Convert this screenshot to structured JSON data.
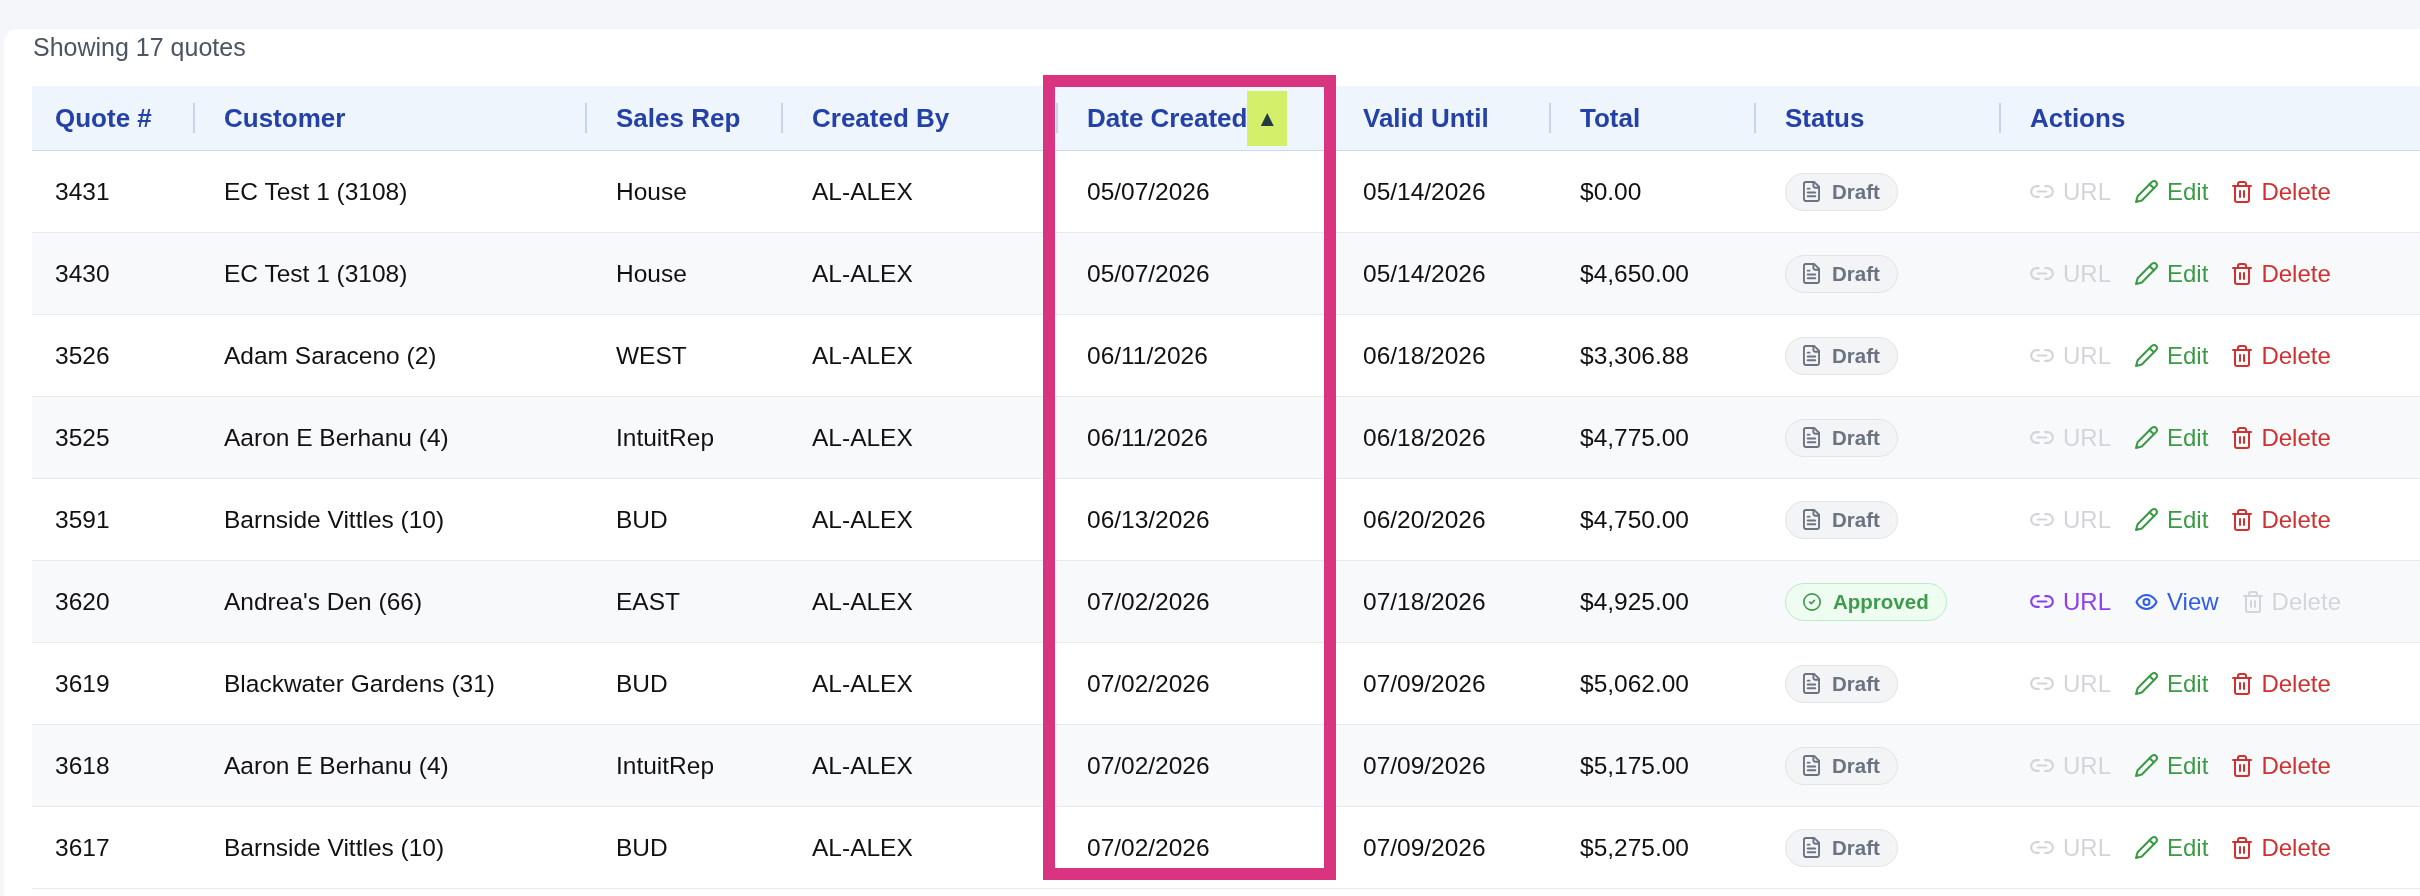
{
  "summary": "Showing 17 quotes",
  "table": {
    "columns": [
      {
        "label": "Quote #",
        "marked": false,
        "framed": false
      },
      {
        "label": "Customer",
        "marked": false,
        "framed": false
      },
      {
        "label": "Sales Rep",
        "marked": false,
        "framed": false
      },
      {
        "label": "Created By",
        "marked": false,
        "framed": false
      },
      {
        "label": "Date Created",
        "sort_indicator": "▲",
        "marked": true,
        "framed": true
      },
      {
        "label": "Valid Until",
        "marked": false,
        "framed": false
      },
      {
        "label": "Total",
        "marked": false,
        "framed": false
      },
      {
        "label": "Status",
        "marked": false,
        "framed": false
      },
      {
        "label": "Actions",
        "marked": false,
        "framed": false
      }
    ],
    "rows": [
      {
        "cells": [
          "3431",
          "EC Test 1 (3108)",
          "House",
          "AL-ALEX",
          "05/07/2026",
          "05/14/2026",
          "$0.00"
        ],
        "status": {
          "kind": "draft",
          "label": "Draft"
        },
        "actions": [
          {
            "kind": "url",
            "label": "URL",
            "disabled": true
          },
          {
            "kind": "edit",
            "label": "Edit",
            "disabled": false
          },
          {
            "kind": "delete",
            "label": "Delete",
            "disabled": false
          }
        ]
      },
      {
        "cells": [
          "3430",
          "EC Test 1 (3108)",
          "House",
          "AL-ALEX",
          "05/07/2026",
          "05/14/2026",
          "$4,650.00"
        ],
        "status": {
          "kind": "draft",
          "label": "Draft"
        },
        "actions": [
          {
            "kind": "url",
            "label": "URL",
            "disabled": true
          },
          {
            "kind": "edit",
            "label": "Edit",
            "disabled": false
          },
          {
            "kind": "delete",
            "label": "Delete",
            "disabled": false
          }
        ]
      },
      {
        "cells": [
          "3526",
          "Adam Saraceno (2)",
          "WEST",
          "AL-ALEX",
          "06/11/2026",
          "06/18/2026",
          "$3,306.88"
        ],
        "status": {
          "kind": "draft",
          "label": "Draft"
        },
        "actions": [
          {
            "kind": "url",
            "label": "URL",
            "disabled": true
          },
          {
            "kind": "edit",
            "label": "Edit",
            "disabled": false
          },
          {
            "kind": "delete",
            "label": "Delete",
            "disabled": false
          }
        ]
      },
      {
        "cells": [
          "3525",
          "Aaron E Berhanu (4)",
          "IntuitRep",
          "AL-ALEX",
          "06/11/2026",
          "06/18/2026",
          "$4,775.00"
        ],
        "status": {
          "kind": "draft",
          "label": "Draft"
        },
        "actions": [
          {
            "kind": "url",
            "label": "URL",
            "disabled": true
          },
          {
            "kind": "edit",
            "label": "Edit",
            "disabled": false
          },
          {
            "kind": "delete",
            "label": "Delete",
            "disabled": false
          }
        ]
      },
      {
        "cells": [
          "3591",
          "Barnside Vittles (10)",
          "BUD",
          "AL-ALEX",
          "06/13/2026",
          "06/20/2026",
          "$4,750.00"
        ],
        "status": {
          "kind": "draft",
          "label": "Draft"
        },
        "actions": [
          {
            "kind": "url",
            "label": "URL",
            "disabled": true
          },
          {
            "kind": "edit",
            "label": "Edit",
            "disabled": false
          },
          {
            "kind": "delete",
            "label": "Delete",
            "disabled": false
          }
        ]
      },
      {
        "cells": [
          "3620",
          "Andrea's Den (66)",
          "EAST",
          "AL-ALEX",
          "07/02/2026",
          "07/18/2026",
          "$4,925.00"
        ],
        "status": {
          "kind": "approved",
          "label": "Approved"
        },
        "actions": [
          {
            "kind": "url",
            "label": "URL",
            "disabled": false
          },
          {
            "kind": "view",
            "label": "View",
            "disabled": false
          },
          {
            "kind": "delete",
            "label": "Delete",
            "disabled": true
          }
        ]
      },
      {
        "cells": [
          "3619",
          "Blackwater Gardens (31)",
          "BUD",
          "AL-ALEX",
          "07/02/2026",
          "07/09/2026",
          "$5,062.00"
        ],
        "status": {
          "kind": "draft",
          "label": "Draft"
        },
        "actions": [
          {
            "kind": "url",
            "label": "URL",
            "disabled": true
          },
          {
            "kind": "edit",
            "label": "Edit",
            "disabled": false
          },
          {
            "kind": "delete",
            "label": "Delete",
            "disabled": false
          }
        ]
      },
      {
        "cells": [
          "3618",
          "Aaron E Berhanu (4)",
          "IntuitRep",
          "AL-ALEX",
          "07/02/2026",
          "07/09/2026",
          "$5,175.00"
        ],
        "status": {
          "kind": "draft",
          "label": "Draft"
        },
        "actions": [
          {
            "kind": "url",
            "label": "URL",
            "disabled": true
          },
          {
            "kind": "edit",
            "label": "Edit",
            "disabled": false
          },
          {
            "kind": "delete",
            "label": "Delete",
            "disabled": false
          }
        ]
      },
      {
        "cells": [
          "3617",
          "Barnside Vittles (10)",
          "BUD",
          "AL-ALEX",
          "07/02/2026",
          "07/09/2026",
          "$5,275.00"
        ],
        "status": {
          "kind": "draft",
          "label": "Draft"
        },
        "actions": [
          {
            "kind": "url",
            "label": "URL",
            "disabled": true
          },
          {
            "kind": "edit",
            "label": "Edit",
            "disabled": false
          },
          {
            "kind": "delete",
            "label": "Delete",
            "disabled": false
          }
        ]
      }
    ]
  }
}
